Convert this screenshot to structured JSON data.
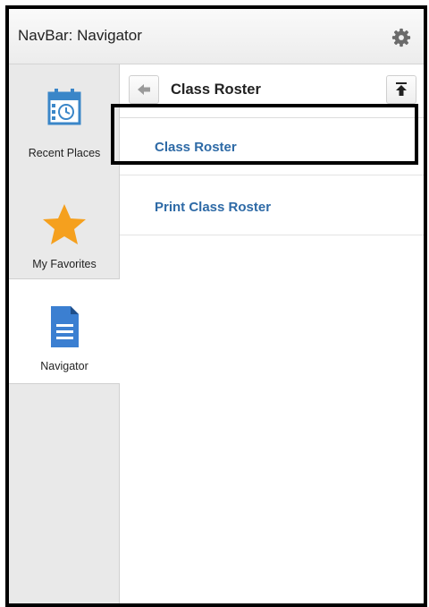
{
  "header": {
    "title": "NavBar: Navigator",
    "settings_icon": "gear-icon"
  },
  "sidebar": {
    "items": [
      {
        "label": "Recent Places",
        "icon": "calendar-clock-icon",
        "active": false
      },
      {
        "label": "My Favorites",
        "icon": "star-icon",
        "active": false
      },
      {
        "label": "Navigator",
        "icon": "document-icon",
        "active": true
      }
    ]
  },
  "content": {
    "breadcrumb_title": "Class Roster",
    "back_icon": "back-arrow-icon",
    "top_icon": "scroll-top-icon",
    "menu": [
      {
        "label": "Class Roster",
        "highlighted": true
      },
      {
        "label": "Print Class Roster",
        "highlighted": false
      }
    ]
  },
  "colors": {
    "link": "#2e6aa6",
    "calendar": "#3a86c8",
    "star": "#f5a01e",
    "document": "#3b7fd1"
  }
}
